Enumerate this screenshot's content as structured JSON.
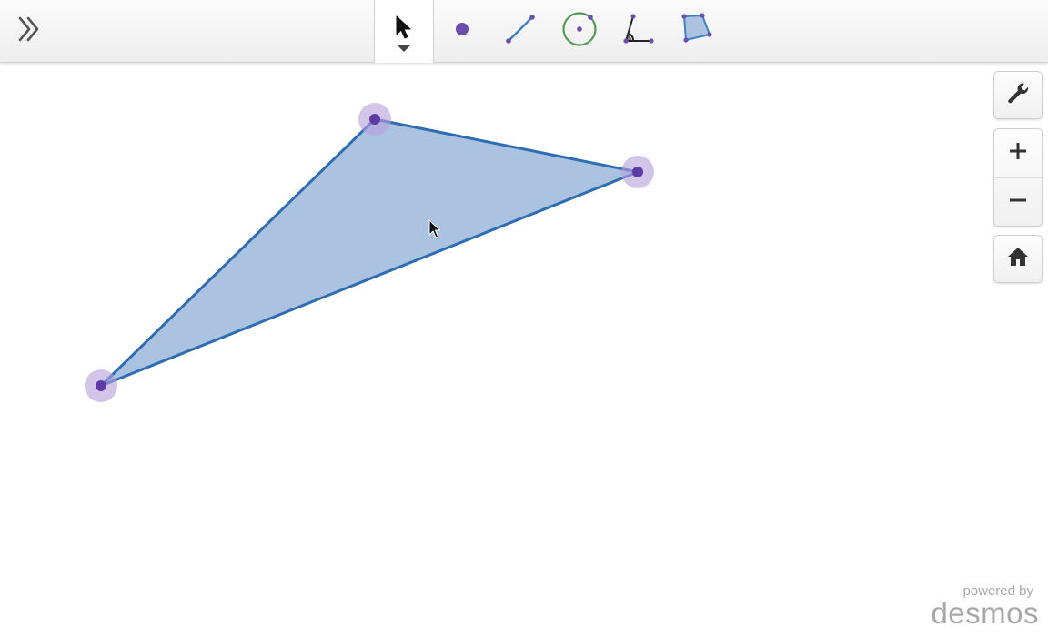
{
  "toolbar": {
    "icons": {
      "expand": "double-chevron-right-icon",
      "select": "arrow-pointer-icon",
      "point": "point-icon",
      "segment": "segment-icon",
      "circle": "circle-icon",
      "angle": "angle-icon",
      "polygon": "polygon-icon"
    },
    "selected_tool": "select"
  },
  "side_controls": {
    "icons": [
      "wrench-icon",
      "plus-icon",
      "minus-icon",
      "home-icon"
    ]
  },
  "branding": {
    "powered_by": "powered by",
    "name": "desmos"
  },
  "colors": {
    "fill": "#abc3e0",
    "stroke": "#2f6db2",
    "point": "#5e3aa6",
    "point_halo": "#c7b7e3",
    "circle_tool": "#4f9a55"
  }
}
